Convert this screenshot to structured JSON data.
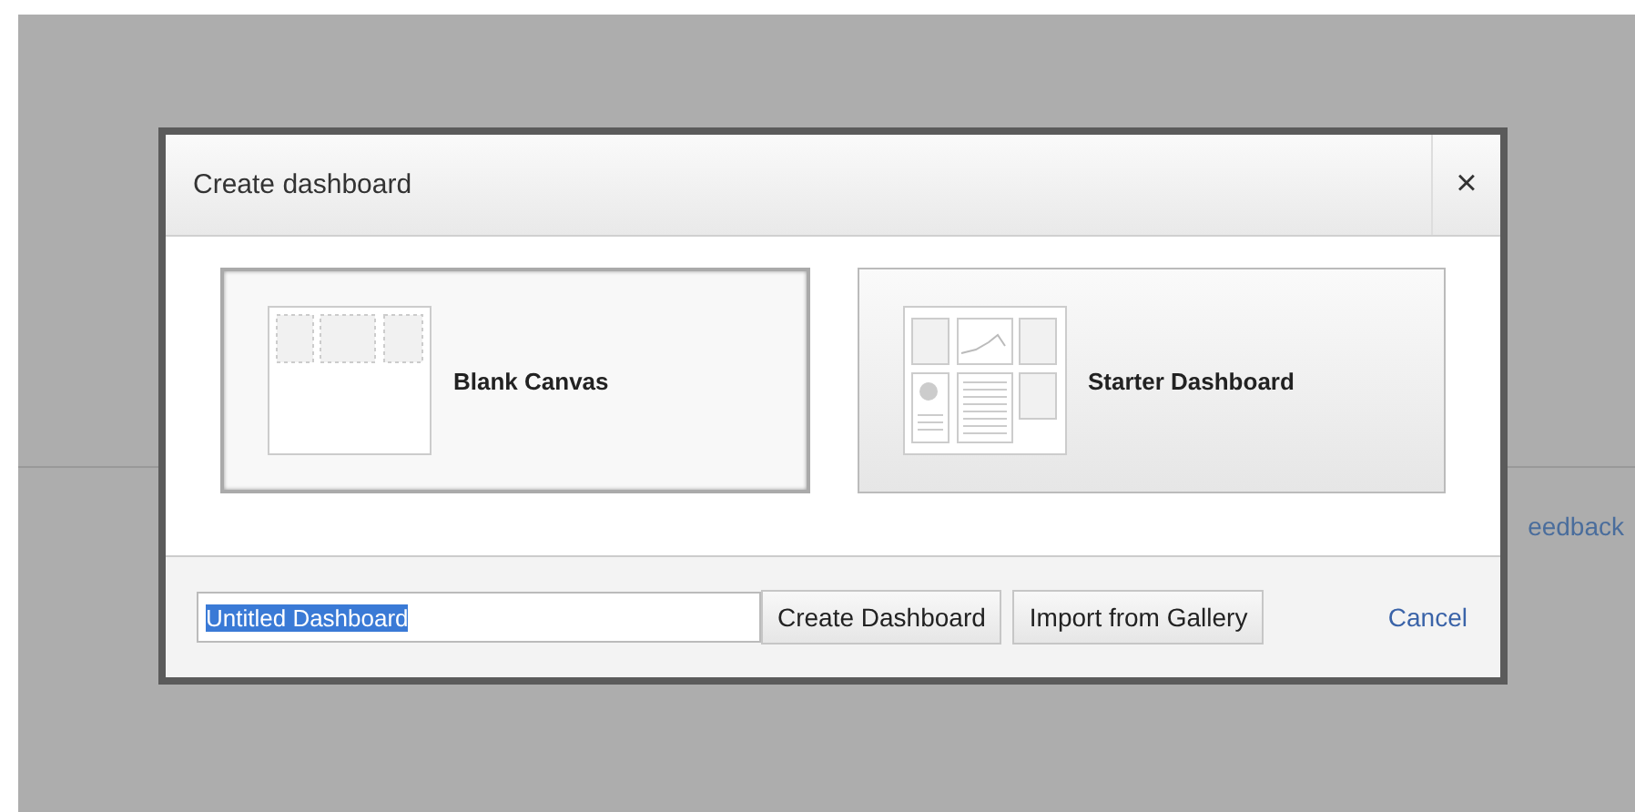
{
  "background": {
    "link": "eedback"
  },
  "dialog": {
    "title": "Create dashboard",
    "close": "×",
    "options": [
      {
        "kind": "blank",
        "label": "Blank Canvas",
        "selected": true
      },
      {
        "kind": "starter",
        "label": "Starter Dashboard",
        "selected": false
      }
    ],
    "name_field": {
      "value": "Untitled Dashboard"
    },
    "buttons": [
      "Create Dashboard",
      "Import from Gallery"
    ],
    "cancel": "Cancel"
  }
}
